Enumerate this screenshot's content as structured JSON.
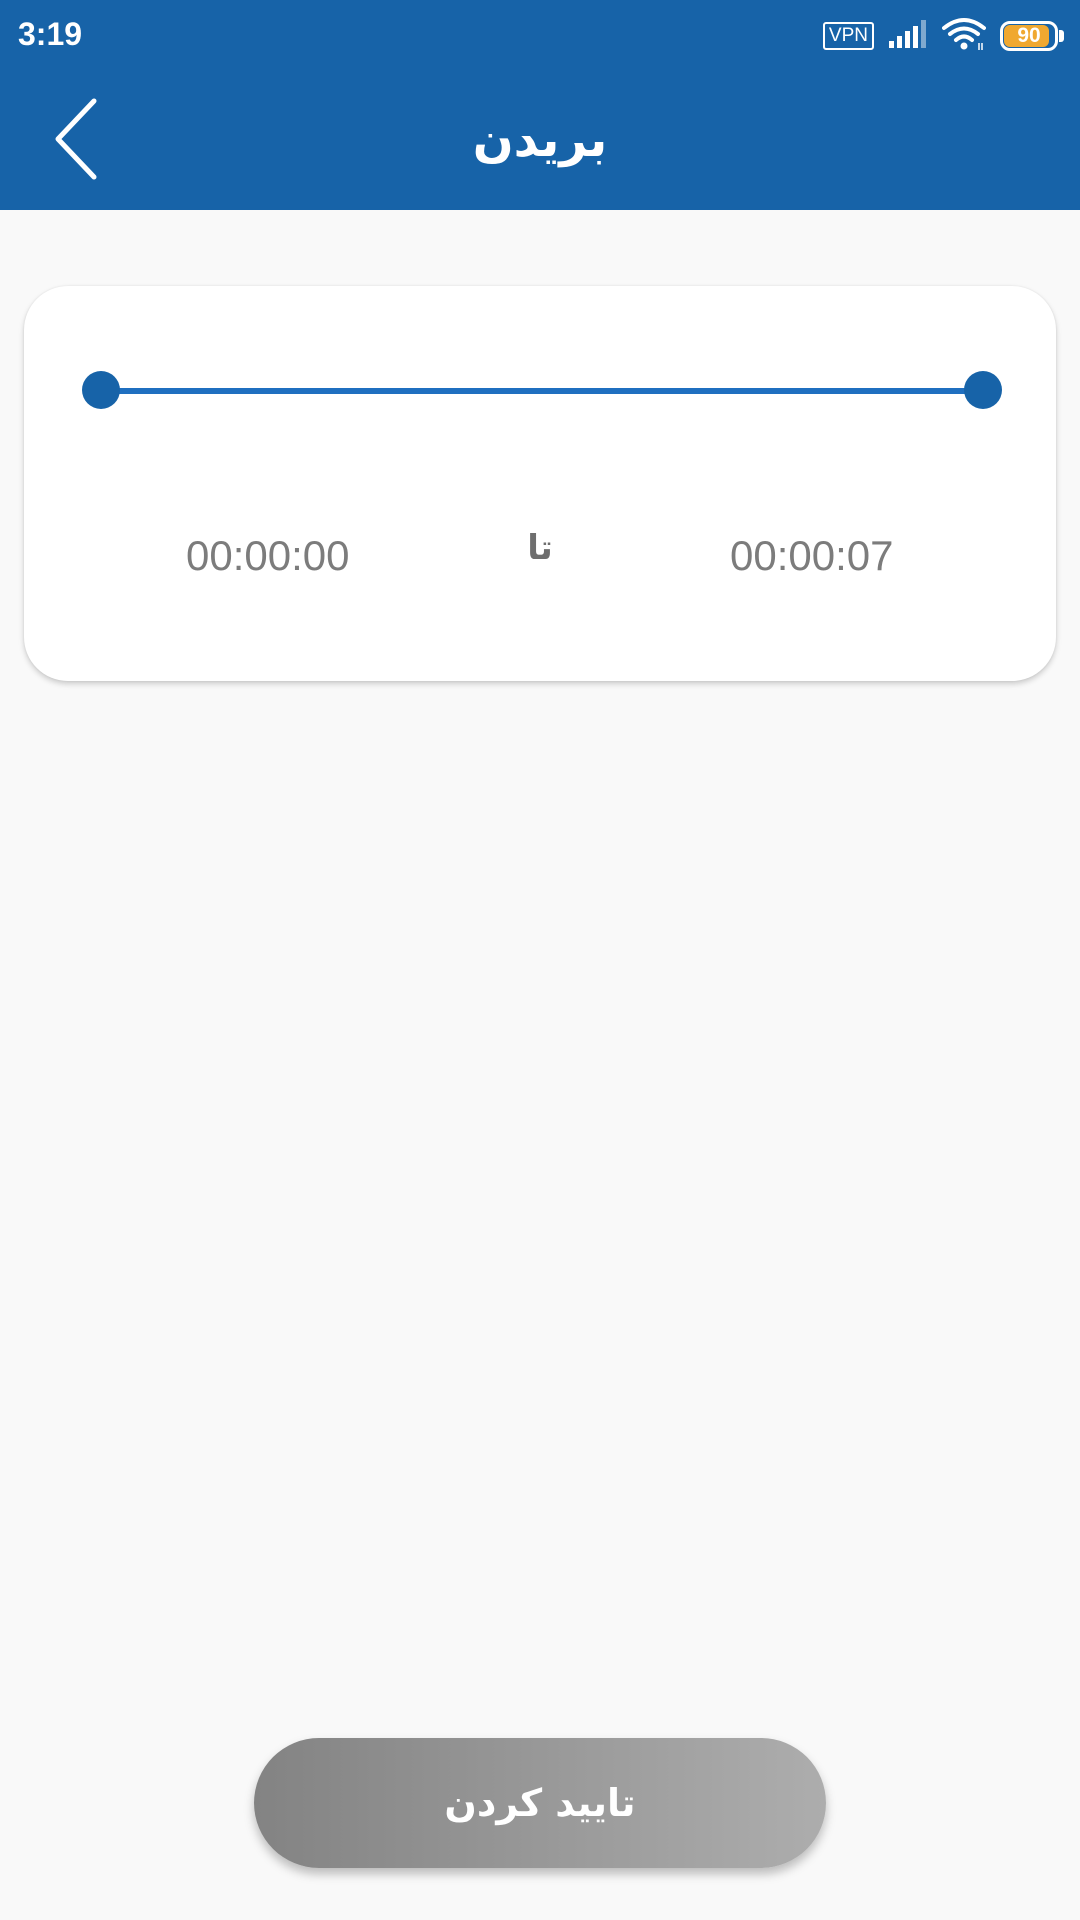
{
  "status_bar": {
    "time": "3:19",
    "vpn_label": "VPN",
    "battery_level": "90",
    "icons": [
      "vpn-icon",
      "signal-icon",
      "wifi-icon",
      "battery-icon"
    ]
  },
  "toolbar": {
    "title": "بریدن",
    "back_icon": "chevron-left-icon"
  },
  "trim": {
    "start_time": "00:00:00",
    "separator": "تا",
    "end_time": "00:00:07",
    "range_start_fraction": 0,
    "range_end_fraction": 1
  },
  "actions": {
    "confirm_label": "تایید کردن"
  },
  "colors": {
    "primary": "#1763a8",
    "slider_track": "#1f6fc0",
    "battery_fill": "#f0a830",
    "background": "#f9f9f9"
  }
}
